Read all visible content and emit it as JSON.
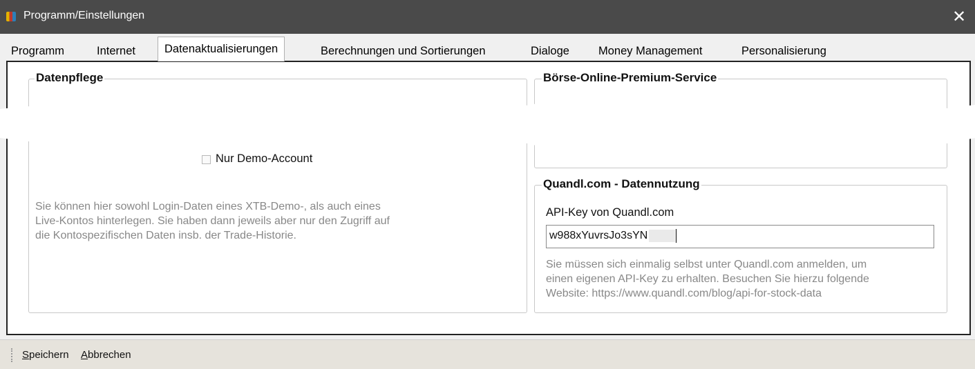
{
  "window": {
    "title": "Programm/Einstellungen",
    "close_glyph": "✕"
  },
  "tabs": [
    {
      "label": "Programm"
    },
    {
      "label": "Internet"
    },
    {
      "label": "Datenaktualisierungen",
      "active": true
    },
    {
      "label": "Berechnungen und Sortierungen"
    },
    {
      "label": "Dialoge"
    },
    {
      "label": "Money Management"
    },
    {
      "label": "Personalisierung"
    }
  ],
  "datenpflege": {
    "title": "Datenpflege",
    "demo_checkbox_label": "Nur Demo-Account",
    "demo_checked": false,
    "info_text_1": "Sie können hier sowohl Login-Daten eines XTB-Demo-, als auch eines",
    "info_text_2": "Live-Kontos hinterlegen. Sie haben dann jeweils aber nur den Zugriff auf",
    "info_text_3": "die Kontospezifischen Daten insb. der Trade-Historie."
  },
  "boerse": {
    "title": "Börse-Online-Premium-Service"
  },
  "quandl": {
    "title": "Quandl.com - Datennutzung",
    "api_label": "API-Key von Quandl.com",
    "api_value": "w988xYuvrsJo3sYN",
    "hint_1": "Sie müssen sich einmalig selbst unter Quandl.com anmelden, um",
    "hint_2": "einen eigenen API-Key zu erhalten. Besuchen Sie hierzu folgende",
    "hint_3": "Website: https://www.quandl.com/blog/api-for-stock-data"
  },
  "statusbar": {
    "save_accel": "S",
    "save_rest": "peichern",
    "cancel_accel": "A",
    "cancel_rest": "bbrechen"
  }
}
